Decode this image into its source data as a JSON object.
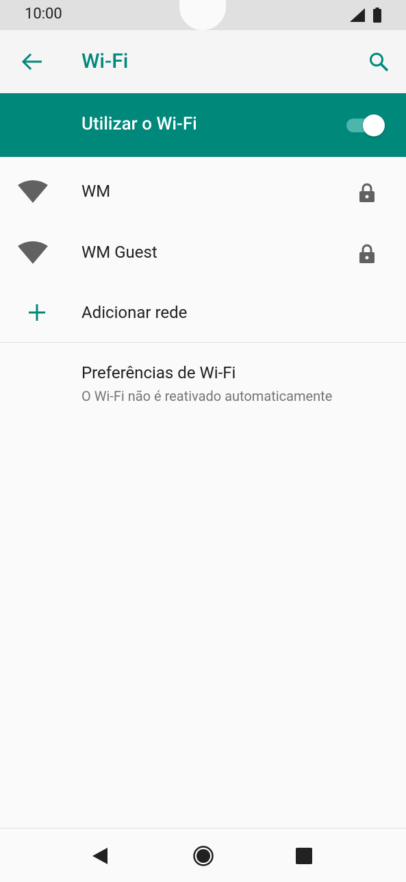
{
  "status_bar": {
    "time": "10:00",
    "icons": [
      "signal-icon",
      "battery-icon"
    ]
  },
  "app_bar": {
    "title": "Wi-Fi",
    "back_icon": "arrow-back-icon",
    "search_icon": "search-icon"
  },
  "master_switch": {
    "label": "Utilizar o Wi-Fi",
    "enabled": true
  },
  "networks": [
    {
      "name": "WM",
      "secured": true
    },
    {
      "name": "WM Guest",
      "secured": true
    }
  ],
  "add_network": {
    "label": "Adicionar rede",
    "icon": "plus-icon"
  },
  "preferences": {
    "title": "Preferências de Wi-Fi",
    "subtitle": "O Wi-Fi não é reativado automaticamente"
  },
  "nav_bar": {
    "icons": [
      "back-triangle-icon",
      "home-circle-icon",
      "recents-square-icon"
    ]
  },
  "colors": {
    "accent": "#00897b",
    "text_primary": "#212121",
    "text_secondary": "#757575",
    "icon_gray": "#616161"
  }
}
